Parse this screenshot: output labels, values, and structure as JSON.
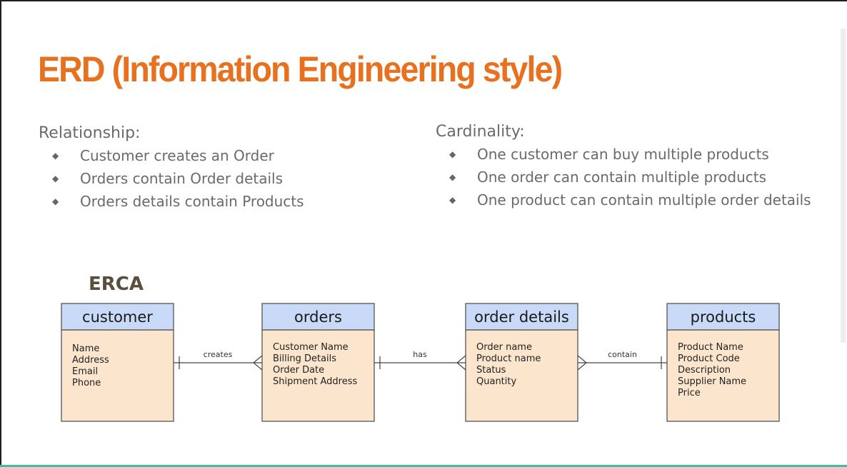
{
  "slide": {
    "title": "ERD (Information Engineering style)",
    "relationship": {
      "heading": "Relationship:",
      "bullets": [
        "Customer creates an Order",
        "Orders contain Order details",
        "Orders details contain Products"
      ]
    },
    "cardinality": {
      "heading": "Cardinality:",
      "bullets": [
        "One customer can buy multiple products",
        "One order can contain multiple products",
        "One product can contain multiple order details"
      ]
    },
    "bullet_glyph": "◆",
    "diagram_label": "ERCA"
  },
  "diagram": {
    "entities": [
      {
        "name": "customer",
        "attributes": [
          "Name",
          "Address",
          "Email",
          "Phone"
        ]
      },
      {
        "name": "orders",
        "attributes": [
          "Customer Name",
          "Billing Details",
          "Order Date",
          "Shipment Address"
        ]
      },
      {
        "name": "order details",
        "attributes": [
          "Order name",
          "Product name",
          "Status",
          "Quantity"
        ]
      },
      {
        "name": "products",
        "attributes": [
          "Product Name",
          "Product Code",
          "Description",
          "Supplier Name",
          "Price"
        ]
      }
    ],
    "relationships": [
      {
        "label": "creates",
        "from": "customer",
        "to": "orders",
        "from_end": "one",
        "to_end": "many"
      },
      {
        "label": "has",
        "from": "orders",
        "to": "order details",
        "from_end": "one",
        "to_end": "many"
      },
      {
        "label": "contain",
        "from": "order details",
        "to": "products",
        "from_end": "many",
        "to_end": "one"
      }
    ]
  },
  "colors": {
    "title": "#e8711f",
    "body_text": "#6a6a6a",
    "entity_header": "#c9daf8",
    "entity_body": "#fce5cd",
    "erca_label": "#5a4e3c",
    "bottom_accent": "#3fbf9a"
  }
}
